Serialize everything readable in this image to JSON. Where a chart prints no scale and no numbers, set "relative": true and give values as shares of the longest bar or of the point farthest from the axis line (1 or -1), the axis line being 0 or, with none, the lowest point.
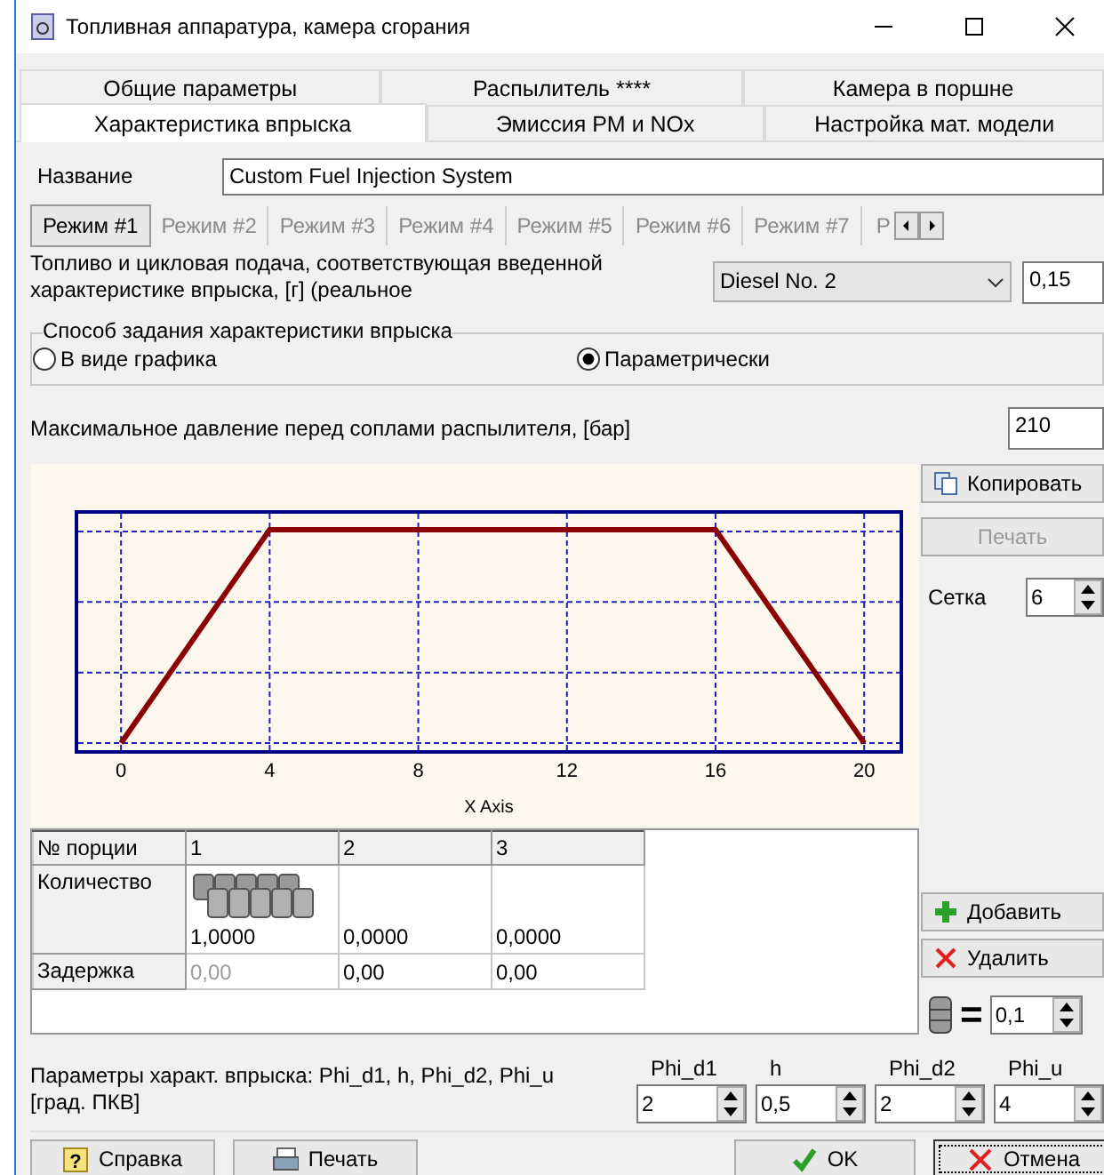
{
  "window": {
    "title": "Топливная аппаратура, камера сгорания"
  },
  "tab_rows": [
    [
      {
        "label": "Общие параметры",
        "selected": false
      },
      {
        "label": "Распылитель ****",
        "selected": false
      },
      {
        "label": "Камера в поршне",
        "selected": false
      }
    ],
    [
      {
        "label": "Характеристика впрыска",
        "selected": true
      },
      {
        "label": "Эмиссия PM и NOx",
        "selected": false
      },
      {
        "label": "Настройка мат. модели",
        "selected": false
      }
    ]
  ],
  "name_field": {
    "label": "Название",
    "value": "Custom Fuel Injection System"
  },
  "mode_tabs": [
    {
      "label": "Режим #1",
      "selected": true
    },
    {
      "label": "Режим #2",
      "selected": false
    },
    {
      "label": "Режим #3",
      "selected": false
    },
    {
      "label": "Режим #4",
      "selected": false
    },
    {
      "label": "Режим #5",
      "selected": false
    },
    {
      "label": "Режим #6",
      "selected": false
    },
    {
      "label": "Режим #7",
      "selected": false
    },
    {
      "label": "Р",
      "selected": false
    }
  ],
  "fuel": {
    "label": "Топливо и цикловая подача, соответствующая введенной характеристике впрыска, [г] (реальное",
    "fuel_type": "Diesel No. 2",
    "amount": "0,15"
  },
  "method_group": {
    "title": "Способ задания характеристики впрыска",
    "options": [
      {
        "label": "В виде графика",
        "selected": false
      },
      {
        "label": "Параметрически",
        "selected": true
      }
    ]
  },
  "max_pressure": {
    "label": "Максимальное давление перед соплами распылителя, [бар]",
    "value": "210"
  },
  "chart": {
    "chart_data": {
      "type": "line",
      "xlabel": "X Axis",
      "x": [
        0,
        4,
        16,
        20
      ],
      "xlim": [
        -1.2,
        21
      ],
      "xticks": [
        0,
        4,
        8,
        12,
        16,
        20
      ],
      "grid": true,
      "relative": true,
      "series": [
        {
          "color": "#8b0000",
          "values": [
            0,
            1,
            1,
            0
          ]
        }
      ]
    }
  },
  "side_buttons": [
    {
      "label": "Копировать",
      "disabled": false
    },
    {
      "label": "Печать",
      "disabled": true
    }
  ],
  "grid_setting": {
    "label": "Сетка",
    "value": "6"
  },
  "portions_table": {
    "columns": [
      "№ порции",
      "1",
      "2",
      "3"
    ],
    "rows": [
      {
        "cells": [
          {
            "text": "Количество",
            "kind": "header",
            "disabled": false
          },
          {
            "text": "1,0000",
            "kind": "barrels",
            "disabled": false
          },
          {
            "text": "0,0000",
            "kind": "plain",
            "disabled": false
          },
          {
            "text": "0,0000",
            "kind": "plain",
            "disabled": false
          }
        ]
      },
      {
        "cells": [
          {
            "text": "Задержка",
            "kind": "header",
            "disabled": false
          },
          {
            "text": "0,00",
            "kind": "plain",
            "disabled": true
          },
          {
            "text": "0,00",
            "kind": "plain",
            "disabled": false
          },
          {
            "text": "0,00",
            "kind": "plain",
            "disabled": false
          }
        ]
      }
    ]
  },
  "table_buttons": [
    {
      "label": "Добавить",
      "kind": "add"
    },
    {
      "label": "Удалить",
      "kind": "delete"
    }
  ],
  "barrel_unit": {
    "sign": "=",
    "value": "0,1"
  },
  "params": {
    "label": "Параметры характ. впрыска: Phi_d1, h, Phi_d2, Phi_u [град. ПКВ]",
    "fields": [
      {
        "label": "Phi_d1",
        "value": "2"
      },
      {
        "label": "h",
        "value": "0,5"
      },
      {
        "label": "Phi_d2",
        "value": "2"
      },
      {
        "label": "Phi_u",
        "value": "4"
      }
    ]
  },
  "footer_buttons": [
    {
      "label": "Справка",
      "kind": "help",
      "icon_text": "?",
      "focused": false
    },
    {
      "label": "Печать",
      "kind": "print",
      "focused": false
    },
    {
      "label": "OK",
      "kind": "ok",
      "focused": false
    },
    {
      "label": "Отмена",
      "kind": "cancel",
      "focused": true
    }
  ]
}
